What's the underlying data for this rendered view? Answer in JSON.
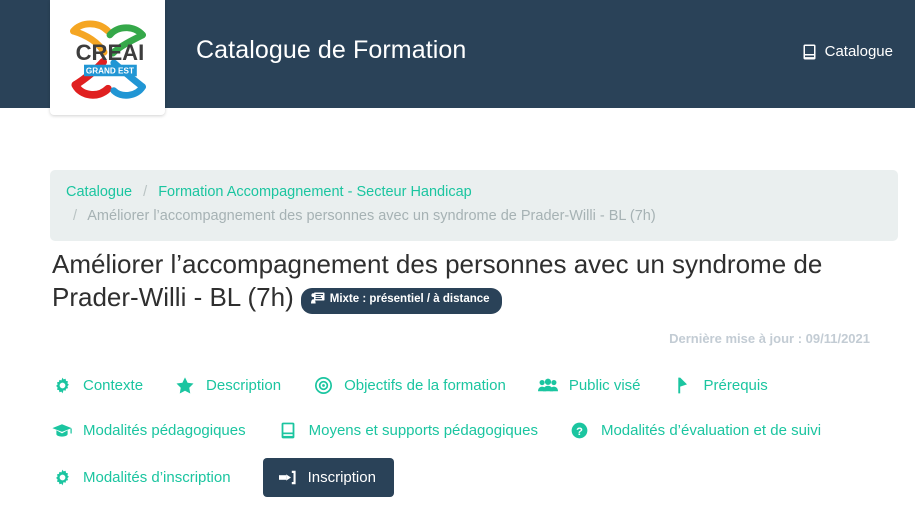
{
  "header": {
    "title": "Catalogue de Formation",
    "logo_alt": "CREAI GRAND EST",
    "logo_text": "CREAI",
    "logo_subtext": "GRAND EST",
    "nav_label": "Catalogue",
    "nav_icon": "book-icon",
    "background_color": "#2a4258"
  },
  "breadcrumb": {
    "items": [
      {
        "label": "Catalogue",
        "current": false
      },
      {
        "label": "Formation Accompagnement - Secteur Handicap",
        "current": false
      },
      {
        "label": "Améliorer l’accompagnement des personnes avec un syndrome de Prader-Willi - BL (7h)",
        "current": true
      }
    ],
    "separator": "/"
  },
  "page": {
    "title": "Améliorer l’accompagnement des personnes avec un syndrome de Prader-Willi - BL (7h)",
    "badge": {
      "label": "Mixte : présentiel / à distance",
      "icon": "chalkboard-teacher-icon"
    },
    "last_update": "Dernière mise à jour : 09/11/2021"
  },
  "accent_color": "#1bc5a0",
  "anchors": {
    "rows": [
      [
        {
          "label": "Contexte",
          "icon": "gear-icon"
        },
        {
          "label": "Description",
          "icon": "star-icon"
        },
        {
          "label": "Objectifs de la formation",
          "icon": "bullseye-icon"
        },
        {
          "label": "Public visé",
          "icon": "users-icon"
        },
        {
          "label": "Prérequis",
          "icon": "flag-icon"
        }
      ],
      [
        {
          "label": "Modalités pédagogiques",
          "icon": "graduation-cap-icon"
        },
        {
          "label": "Moyens et supports pédagogiques",
          "icon": "book-icon"
        },
        {
          "label": "Modalités d’évaluation et de suivi",
          "icon": "question-circle-icon"
        }
      ],
      [
        {
          "label": "Modalités d’inscription",
          "icon": "gear-icon"
        }
      ]
    ]
  },
  "cta": {
    "label": "Inscription",
    "icon": "sign-in-icon"
  }
}
